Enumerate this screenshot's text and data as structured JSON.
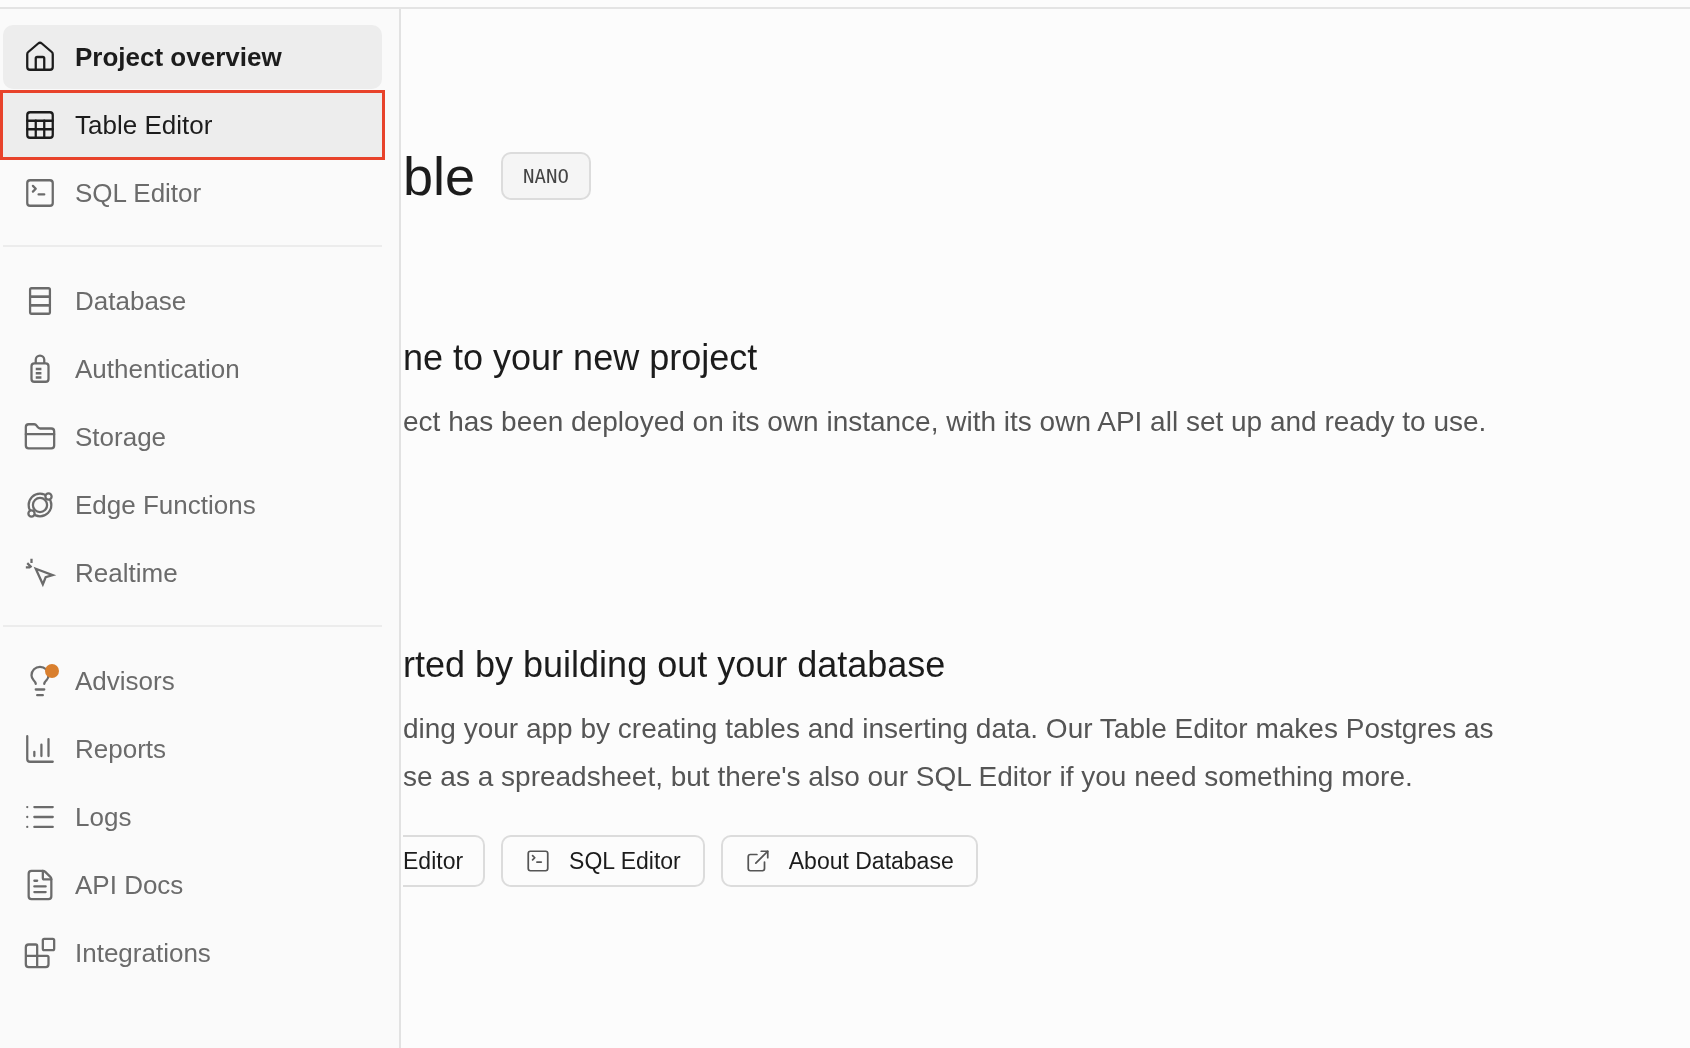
{
  "sidebar": {
    "groups": [
      {
        "items": [
          {
            "label": "Project overview",
            "selected": true,
            "highlighted": false,
            "alert": false
          },
          {
            "label": "Table Editor",
            "selected": false,
            "highlighted": true,
            "alert": false
          },
          {
            "label": "SQL Editor",
            "selected": false,
            "highlighted": false,
            "alert": false
          }
        ]
      },
      {
        "items": [
          {
            "label": "Database",
            "selected": false,
            "highlighted": false,
            "alert": false
          },
          {
            "label": "Authentication",
            "selected": false,
            "highlighted": false,
            "alert": false
          },
          {
            "label": "Storage",
            "selected": false,
            "highlighted": false,
            "alert": false
          },
          {
            "label": "Edge Functions",
            "selected": false,
            "highlighted": false,
            "alert": false
          },
          {
            "label": "Realtime",
            "selected": false,
            "highlighted": false,
            "alert": false
          }
        ]
      },
      {
        "items": [
          {
            "label": "Advisors",
            "selected": false,
            "highlighted": false,
            "alert": true
          },
          {
            "label": "Reports",
            "selected": false,
            "highlighted": false,
            "alert": false
          },
          {
            "label": "Logs",
            "selected": false,
            "highlighted": false,
            "alert": false
          },
          {
            "label": "API Docs",
            "selected": false,
            "highlighted": false,
            "alert": false
          },
          {
            "label": "Integrations",
            "selected": false,
            "highlighted": false,
            "alert": false
          }
        ]
      }
    ]
  },
  "main": {
    "title": "ble",
    "badge": "NANO",
    "sections": [
      {
        "heading": "ne to your new project",
        "lines": [
          "ect has been deployed on its own instance, with its own API all set up and ready to use."
        ]
      },
      {
        "heading": "rted by building out your database",
        "lines": [
          "ding your app by creating tables and inserting data. Our Table Editor makes Postgres as",
          "se as a spreadsheet, but there's also our SQL Editor if you need something more."
        ]
      }
    ],
    "buttons": [
      "Editor",
      "SQL Editor",
      "About Database"
    ]
  }
}
